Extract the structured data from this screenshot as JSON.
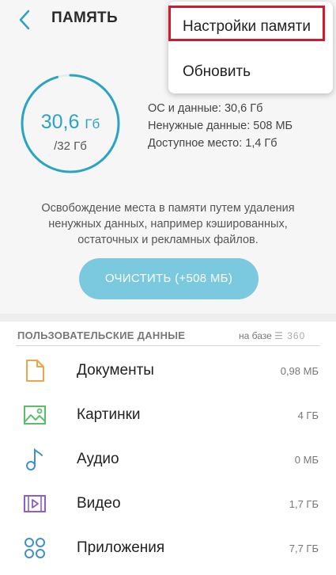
{
  "header": {
    "title": "ПАМЯТЬ"
  },
  "menu": {
    "items": [
      {
        "label": "Настройки памяти"
      },
      {
        "label": "Обновить"
      }
    ]
  },
  "gauge": {
    "used": "30,6",
    "unit": "Гб",
    "total": "/32 Гб",
    "fill_fraction": 0.956,
    "color": "#2aa4c2"
  },
  "stats": {
    "os": "ОС и данные: 30,6 Гб",
    "junk": "Ненужные данные: 508 МБ",
    "free": "Доступное место: 1,4 Гб"
  },
  "description": {
    "line1": "Освобождение места в памяти путем удаления",
    "line2": "ненужных данных, например кэшированных,",
    "line3": "остаточных и рекламных файлов."
  },
  "clean_button": {
    "label": "ОЧИСТИТЬ (+508 МБ)"
  },
  "user_data": {
    "title": "ПОЛЬЗОВАТЕЛЬСКИЕ ДАННЫЕ",
    "powered_by": "на базе",
    "powered_logo": "360",
    "items": [
      {
        "name": "Документы",
        "size": "0,98 МБ",
        "icon": "document-icon",
        "color": "#f0a44a"
      },
      {
        "name": "Картинки",
        "size": "4 ГБ",
        "icon": "image-icon",
        "color": "#5bbf6a"
      },
      {
        "name": "Аудио",
        "size": "0 МБ",
        "icon": "music-note-icon",
        "color": "#3f8fd8"
      },
      {
        "name": "Видео",
        "size": "1,7 ГБ",
        "icon": "video-icon",
        "color": "#8a5fd0"
      },
      {
        "name": "Приложения",
        "size": "7,7 ГБ",
        "icon": "apps-icon",
        "color": "#3f8fd8"
      }
    ]
  }
}
